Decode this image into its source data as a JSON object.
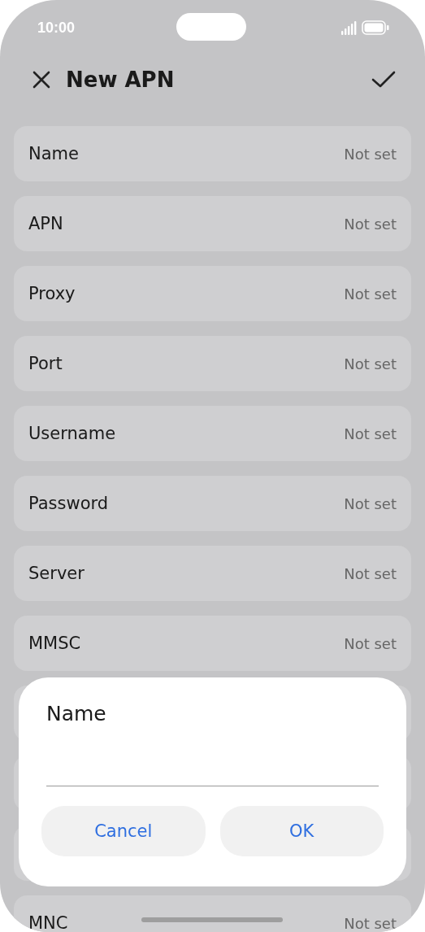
{
  "status_bar": {
    "time": "10:00"
  },
  "header": {
    "title": "New APN"
  },
  "fields": [
    {
      "label": "Name",
      "value": "Not set"
    },
    {
      "label": "APN",
      "value": "Not set"
    },
    {
      "label": "Proxy",
      "value": "Not set"
    },
    {
      "label": "Port",
      "value": "Not set"
    },
    {
      "label": "Username",
      "value": "Not set"
    },
    {
      "label": "Password",
      "value": "Not set"
    },
    {
      "label": "Server",
      "value": "Not set"
    },
    {
      "label": "MMSC",
      "value": "Not set"
    }
  ],
  "fields_below_dialog": [
    {
      "label": "MNC",
      "value": "Not set"
    }
  ],
  "dialog": {
    "title": "Name",
    "buttons": [
      "Cancel",
      "OK"
    ]
  }
}
